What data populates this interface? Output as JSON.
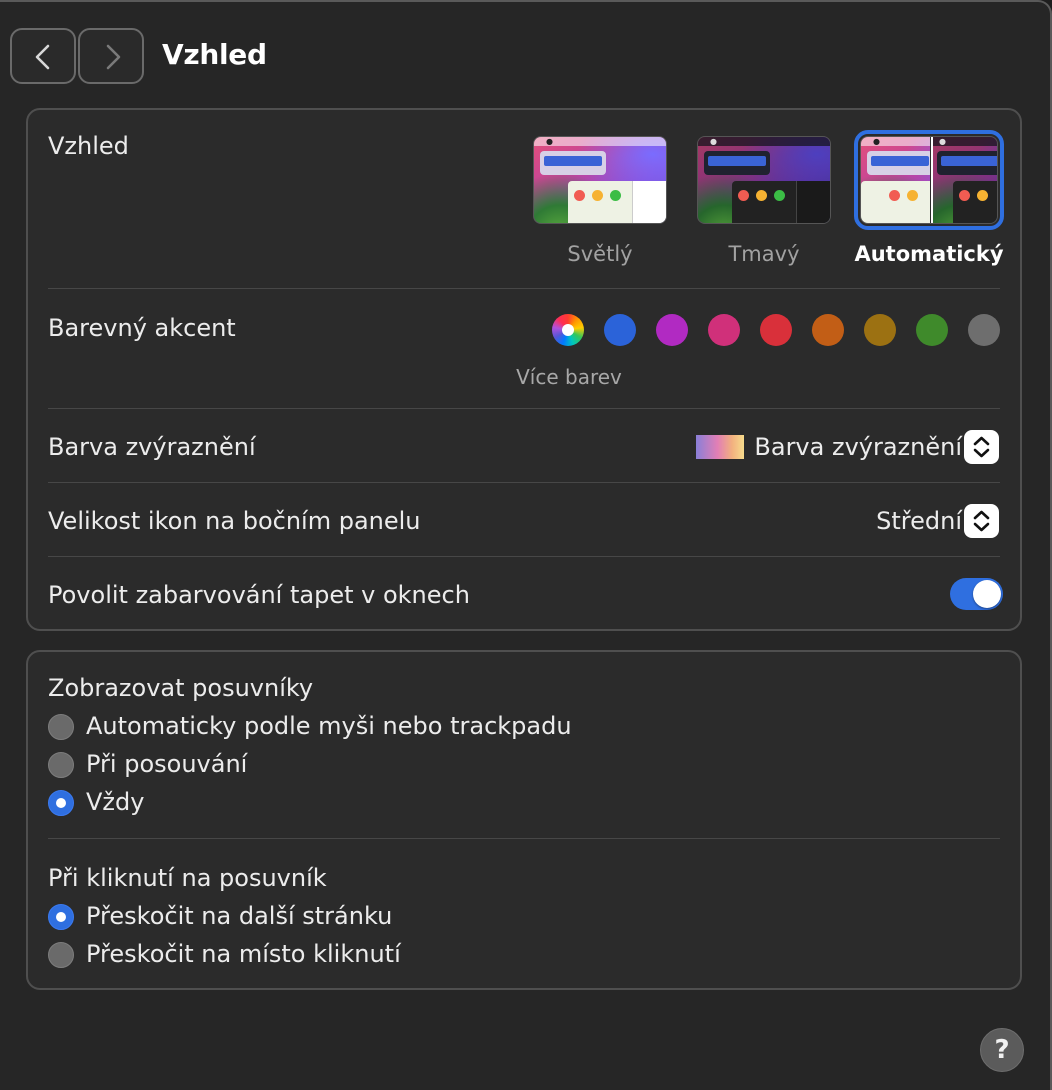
{
  "header": {
    "title": "Vzhled"
  },
  "appearance": {
    "label": "Vzhled",
    "options": [
      {
        "label": "Světlý",
        "selected": false
      },
      {
        "label": "Tmavý",
        "selected": false
      },
      {
        "label": "Automatický",
        "selected": true
      }
    ]
  },
  "accent": {
    "label": "Barevný akcent",
    "multicolor_label": "Více barev",
    "colors": [
      "multicolor",
      "#2b63d9",
      "#b12ac2",
      "#d0307a",
      "#d9303a",
      "#c25e16",
      "#9c7112",
      "#3f8a2b",
      "#6e6e6e"
    ],
    "selected": "multicolor"
  },
  "highlight": {
    "label": "Barva zvýraznění",
    "value": "Barva zvýraznění"
  },
  "sidebar_icons": {
    "label": "Velikost ikon na bočním panelu",
    "value": "Střední"
  },
  "wallpaper_tinting": {
    "label": "Povolit zabarvování tapet v oknech",
    "enabled": true
  },
  "scrollbars": {
    "label": "Zobrazovat posuvníky",
    "options": [
      {
        "label": "Automaticky podle myši nebo trackpadu",
        "selected": false
      },
      {
        "label": "Při posouvání",
        "selected": false
      },
      {
        "label": "Vždy",
        "selected": true
      }
    ]
  },
  "scroll_click": {
    "label": "Při kliknutí na posuvník",
    "options": [
      {
        "label": "Přeskočit na další stránku",
        "selected": true
      },
      {
        "label": "Přeskočit na místo kliknutí",
        "selected": false
      }
    ]
  },
  "help": {
    "label": "?"
  }
}
